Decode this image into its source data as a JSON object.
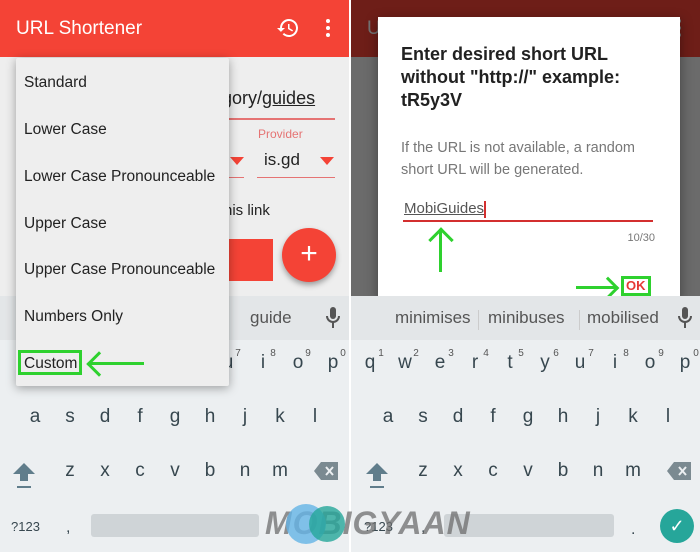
{
  "left": {
    "appbar": {
      "title": "URL Shortener",
      "history_icon": "history-icon",
      "more_icon": "more-vert-icon"
    },
    "form": {
      "url_value_prefix": "gory/",
      "url_value_link": "guides",
      "provider_label": "Provider",
      "provider_value": "is.gd",
      "checkbox_label_partial": "his link",
      "fab_label": "+"
    },
    "menu": {
      "items": [
        "Standard",
        "Lower Case",
        "Lower Case Pronounceable",
        "Upper Case",
        "Upper Case Pronounceable",
        "Numbers Only",
        "Custom"
      ],
      "highlighted": "Custom"
    },
    "keyboard": {
      "suggestions": [
        "guide"
      ],
      "numbers": [
        "7",
        "8",
        "9",
        "0"
      ],
      "row1_visible": [
        "u",
        "i",
        "o",
        "p"
      ],
      "row2": [
        "a",
        "s",
        "d",
        "f",
        "g",
        "h",
        "j",
        "k",
        "l"
      ],
      "row3": [
        "z",
        "x",
        "c",
        "v",
        "b",
        "n",
        "m"
      ],
      "symbols_key": "?123",
      "comma_key": ","
    }
  },
  "right": {
    "dialog": {
      "title": "Enter desired short URL without \"http://\" example: tR5y3V",
      "message": "If the URL is not available, a random short URL will be generated.",
      "input_value": "MobiGuides",
      "counter": "10/30",
      "ok_label": "OK"
    },
    "keyboard": {
      "suggestions": [
        "minimises",
        "minibuses",
        "mobilised"
      ],
      "numbers": [
        "1",
        "2",
        "3",
        "4",
        "5",
        "6",
        "7",
        "8",
        "9",
        "0"
      ],
      "row1": [
        "q",
        "w",
        "e",
        "r",
        "t",
        "y",
        "u",
        "i",
        "o",
        "p"
      ],
      "row2": [
        "a",
        "s",
        "d",
        "f",
        "g",
        "h",
        "j",
        "k",
        "l"
      ],
      "row3": [
        "z",
        "x",
        "c",
        "v",
        "b",
        "n",
        "m"
      ],
      "symbols_key": "?123",
      "comma_key": ",",
      "period_key": ".",
      "enter_icon": "check-icon"
    }
  },
  "watermark": "MOBIGYAAN",
  "colors": {
    "primary": "#f44336",
    "annotation": "#2ed12e",
    "enter": "#26a69a"
  }
}
